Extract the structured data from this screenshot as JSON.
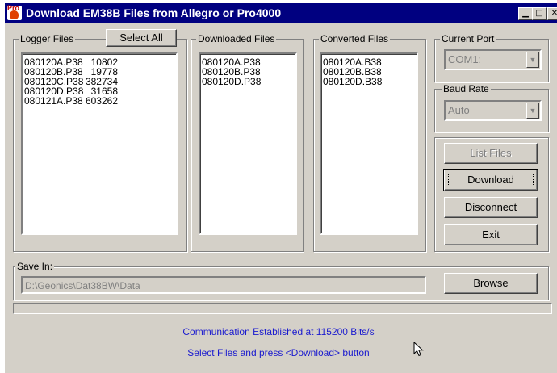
{
  "window": {
    "title": "Download EM38B Files from Allegro or Pro4000",
    "icon_text": "Pro",
    "controls": {
      "minimize": "▁",
      "maximize": "□",
      "close": "✕"
    }
  },
  "logger_files": {
    "label": "Logger Files",
    "select_all_label": "Select All",
    "items": [
      {
        "name": "080120A.P38",
        "size": "10802"
      },
      {
        "name": "080120B.P38",
        "size": "19778"
      },
      {
        "name": "080120C.P38",
        "size": "382734"
      },
      {
        "name": "080120D.P38",
        "size": "31658"
      },
      {
        "name": "080121A.P38",
        "size": "603262"
      }
    ]
  },
  "downloaded_files": {
    "label": "Downloaded Files",
    "items": [
      "080120A.P38",
      "080120B.P38",
      "080120D.P38"
    ]
  },
  "converted_files": {
    "label": "Converted Files",
    "items": [
      "080120A.B38",
      "080120B.B38",
      "080120D.B38"
    ]
  },
  "current_port": {
    "label": "Current Port",
    "value": "COM1:"
  },
  "baud_rate": {
    "label": "Baud Rate",
    "value": "Auto"
  },
  "buttons": {
    "list_files": "List Files",
    "download": "Download",
    "disconnect": "Disconnect",
    "exit": "Exit",
    "browse": "Browse"
  },
  "save_in": {
    "label": "Save In:",
    "path": "D:\\Geonics\\Dat38BW\\Data"
  },
  "status": {
    "line1": "Communication Established at 115200 Bits/s",
    "line2": "Select Files and press <Download> button"
  }
}
